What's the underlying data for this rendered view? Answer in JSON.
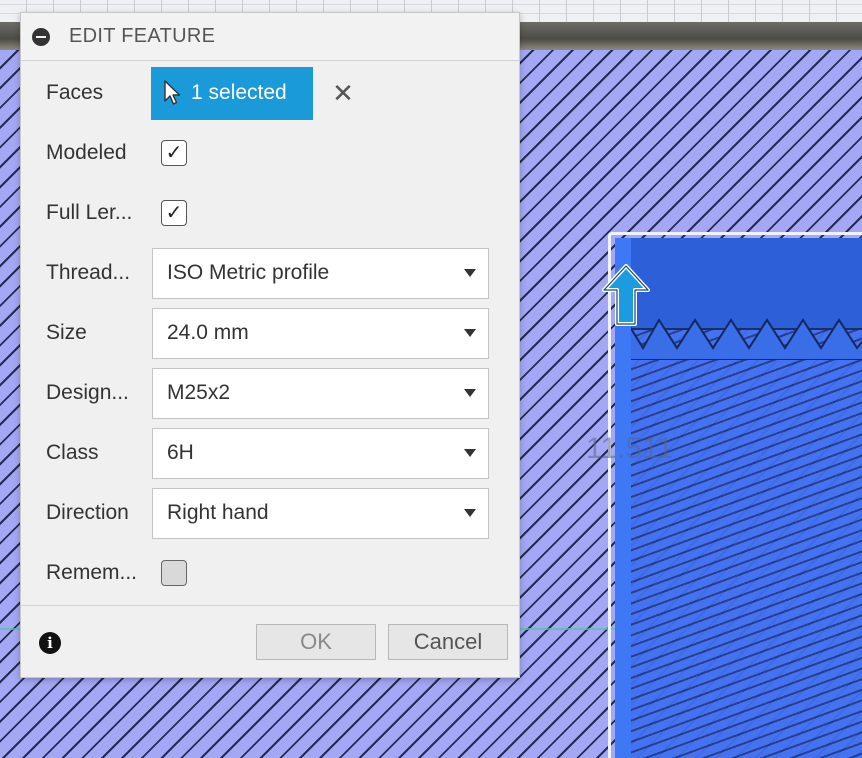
{
  "dialog": {
    "title": "EDIT FEATURE",
    "rows": [
      {
        "label": "Faces",
        "control": "selection",
        "value": "1 selected"
      },
      {
        "label": "Modeled",
        "control": "checkbox",
        "checked": true
      },
      {
        "label": "Full Ler...",
        "control": "checkbox",
        "checked": true
      },
      {
        "label": "Thread...",
        "control": "dropdown",
        "value": "ISO Metric profile"
      },
      {
        "label": "Size",
        "control": "dropdown",
        "value": "24.0 mm"
      },
      {
        "label": "Design...",
        "control": "dropdown",
        "value": "M25x2"
      },
      {
        "label": "Class",
        "control": "dropdown",
        "value": "6H"
      },
      {
        "label": "Direction",
        "control": "dropdown",
        "value": "Right hand"
      },
      {
        "label": "Remem...",
        "control": "checkbox",
        "checked": false
      }
    ],
    "ok_label": "OK",
    "cancel_label": "Cancel",
    "clear_symbol": "✕",
    "checkmark_symbol": "✓",
    "info_symbol": "i"
  },
  "viewport": {
    "dimension_label": "11.511"
  },
  "colors": {
    "accent": "#1a9ad9",
    "viewport_hatch": "#a4a8f4",
    "body_blue": "#3f6ff0"
  },
  "icons": {
    "collapse": "collapse-icon",
    "cursor": "cursor-arrow-icon",
    "clear": "close-icon",
    "info": "info-icon",
    "move_arrow": "up-arrow-icon"
  }
}
